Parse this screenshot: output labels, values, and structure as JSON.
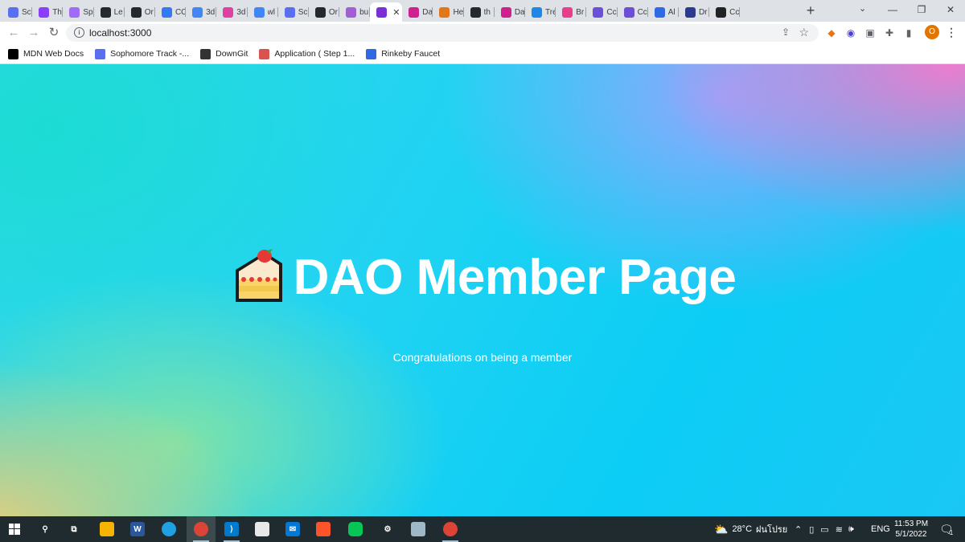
{
  "browser": {
    "tabs": [
      {
        "title": "Sc",
        "icon": "diamond-icon",
        "color": "#5a6ef0"
      },
      {
        "title": "Th",
        "icon": "circle-logo-icon",
        "color": "#8a3ffc"
      },
      {
        "title": "Sp",
        "icon": "gradient-circle-icon",
        "color": "#a06cf5"
      },
      {
        "title": "Le",
        "icon": "github-icon",
        "color": "#24292e"
      },
      {
        "title": "Or",
        "icon": "github-icon",
        "color": "#24292e"
      },
      {
        "title": "CC",
        "icon": "c-logo-icon",
        "color": "#3478f6"
      },
      {
        "title": "3d",
        "icon": "google-icon",
        "color": "#4285f4"
      },
      {
        "title": "3d",
        "icon": "3d-icon",
        "color": "#e040a0"
      },
      {
        "title": "wl",
        "icon": "google-icon",
        "color": "#4285f4"
      },
      {
        "title": "Sc",
        "icon": "diamond-icon",
        "color": "#5a6ef0"
      },
      {
        "title": "Or",
        "icon": "github-icon",
        "color": "#24292e"
      },
      {
        "title": "bu",
        "icon": "unicorn-icon",
        "color": "#a060d0"
      },
      {
        "title": "",
        "icon": "people-icon",
        "color": "#7b2fd8",
        "active": true
      },
      {
        "title": "Da",
        "icon": "w-logo-icon",
        "color": "#d02090"
      },
      {
        "title": "He",
        "icon": "fox-icon",
        "color": "#e2761b"
      },
      {
        "title": "th",
        "icon": "github-icon",
        "color": "#24292e"
      },
      {
        "title": "Da",
        "icon": "w-logo-icon",
        "color": "#d02090"
      },
      {
        "title": "Tre",
        "icon": "c-logo-icon",
        "color": "#1e88e5"
      },
      {
        "title": "Br",
        "icon": "stack-icon",
        "color": "#e83e8c"
      },
      {
        "title": "Cc",
        "icon": "planet-icon",
        "color": "#6b4fd8"
      },
      {
        "title": "Cc",
        "icon": "planet-icon",
        "color": "#6b4fd8"
      },
      {
        "title": "Al",
        "icon": "triangle-logo-icon",
        "color": "#2d6ae3"
      },
      {
        "title": "Dr",
        "icon": "chart-logo-icon",
        "color": "#2b3a8c"
      },
      {
        "title": "Cc",
        "icon": "x-logo-icon",
        "color": "#222222"
      }
    ],
    "address": "localhost:3000",
    "profile_initial": "O",
    "bookmarks": [
      {
        "label": "MDN Web Docs",
        "icon": "mdn-icon",
        "color": "#000000"
      },
      {
        "label": "Sophomore Track -...",
        "icon": "diamond-icon",
        "color": "#5a6ef0"
      },
      {
        "label": "DownGit",
        "icon": "downgit-icon",
        "color": "#333333"
      },
      {
        "label": "Application ( Step 1...",
        "icon": "document-icon",
        "color": "#d9534f"
      },
      {
        "label": "Rinkeby Faucet",
        "icon": "triangle-logo-icon",
        "color": "#2d6ae3"
      }
    ]
  },
  "page": {
    "emoji_icon": "shortcake-icon",
    "heading": "DAO Member Page",
    "subtitle": "Congratulations on being a member"
  },
  "taskbar": {
    "weather": "28°C",
    "weather_desc": "ฝนโปรย",
    "language": "ENG",
    "time": "11:53 PM",
    "date": "5/1/2022",
    "notification_count": "1"
  }
}
